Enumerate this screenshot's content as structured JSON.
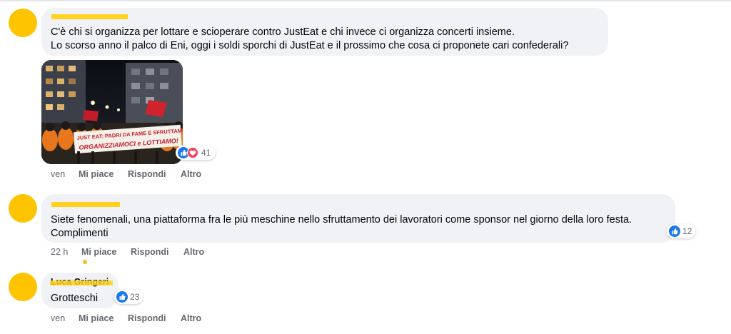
{
  "comments": [
    {
      "author_name": "",
      "lines": [
        "C'è chi si organizza per lottare e scioperare contro JustEat e chi invece ci organizza concerti insieme.",
        "Lo scorso anno il palco di Eni, oggi i soldi sporchi di JustEat e il prossimo che cosa ci proponete cari confederali?"
      ],
      "image": {
        "banner_line1": "JUST EAT: PADRI DA FAME E SFRUTTAMENTO",
        "banner_line2": "ORGANIZZIAMOCI e LOTTIAMO!"
      },
      "reactions": {
        "icons": [
          "like-icon",
          "love-icon"
        ],
        "count": "41"
      },
      "actions": {
        "time": "ven",
        "like": "Mi piace",
        "reply": "Rispondi",
        "more": "Altro"
      }
    },
    {
      "author_name": "",
      "lines": [
        "Siete fenomenali, una piattaforma fra le più meschine nello sfruttamento dei lavoratori come sponsor nel giorno della loro festa.",
        "Complimenti"
      ],
      "reactions": {
        "icons": [
          "like-icon"
        ],
        "count": "12"
      },
      "actions": {
        "time": "22 h",
        "like": "Mi piace",
        "reply": "Rispondi",
        "more": "Altro"
      }
    },
    {
      "author_name": "Luca Gringeri",
      "lines": [
        "Grotteschi"
      ],
      "reactions": {
        "icons": [
          "like-icon"
        ],
        "count": "23"
      },
      "actions": {
        "time": "ven",
        "like": "Mi piace",
        "reply": "Rispondi",
        "more": "Altro"
      }
    }
  ],
  "colors": {
    "avatar": "#ffc400",
    "redaction": "#ffd21f",
    "bubble": "#f0f2f5",
    "like": "#1877f2",
    "love": "#f33e58",
    "meta_text": "#65676b"
  }
}
